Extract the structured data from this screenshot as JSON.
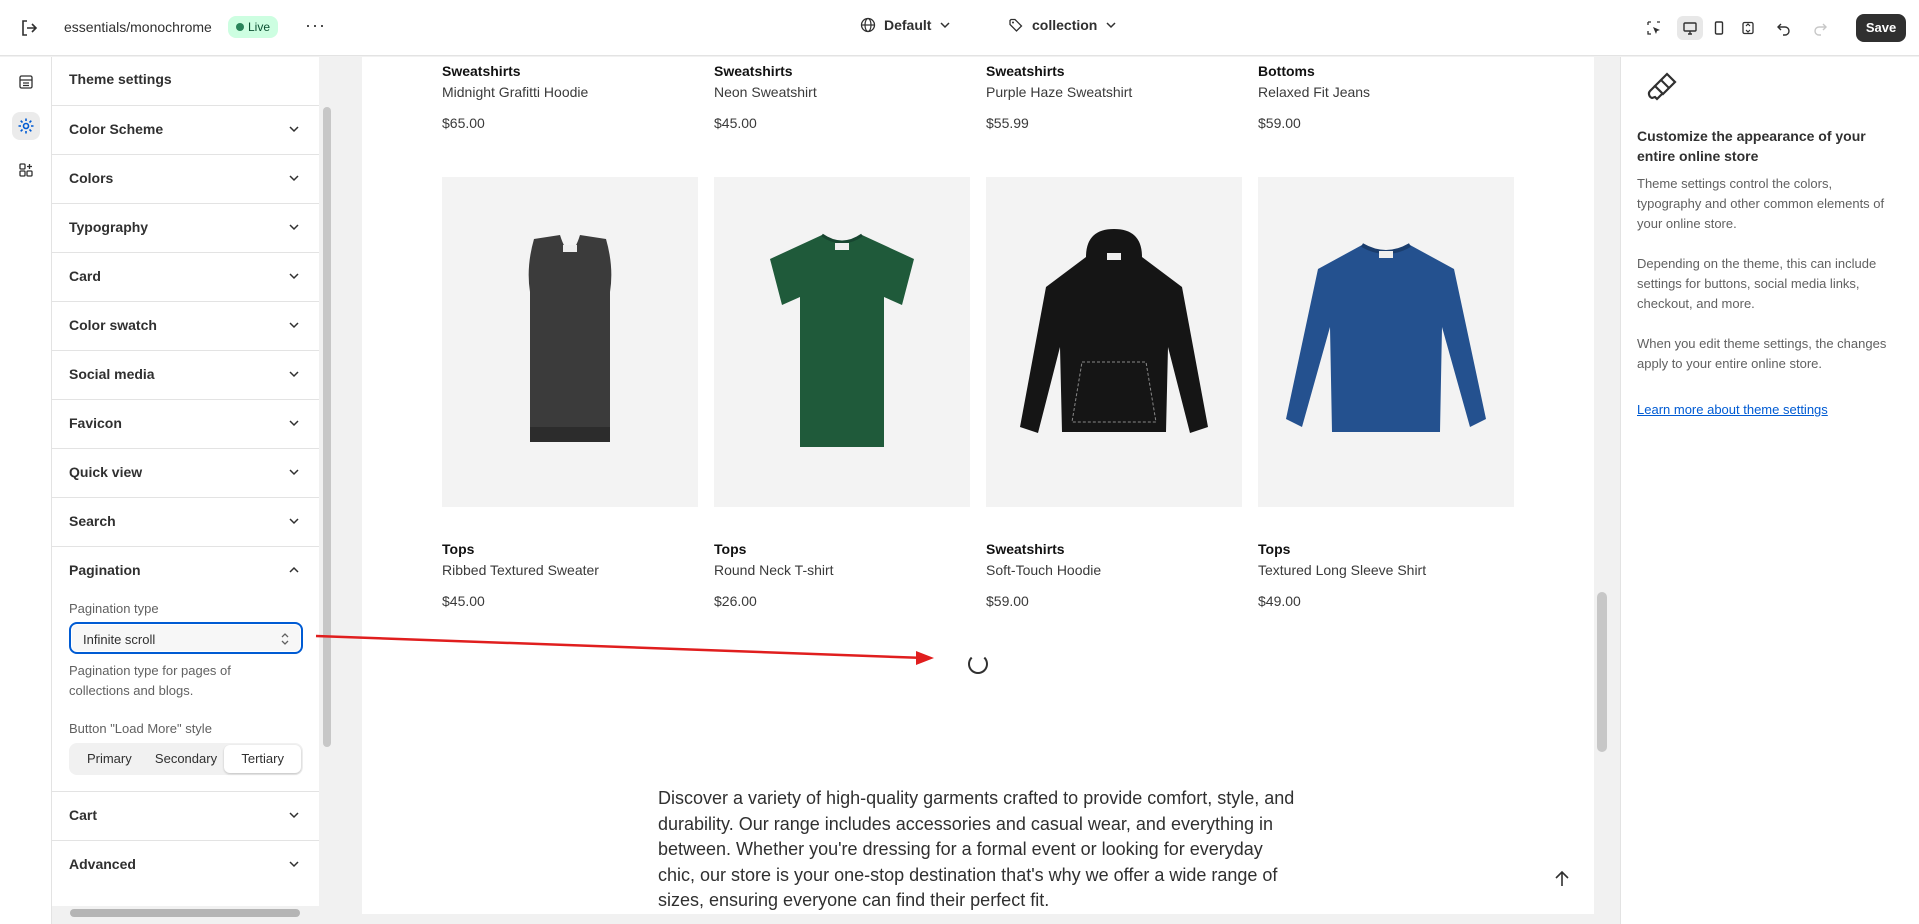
{
  "topbar": {
    "store_name": "essentials/monochrome",
    "status_badge": "Live",
    "more": "···",
    "theme_select": "Default",
    "template_select": "collection",
    "save_label": "Save"
  },
  "settings": {
    "title": "Theme settings",
    "sections": [
      {
        "label": "Color Scheme"
      },
      {
        "label": "Colors"
      },
      {
        "label": "Typography"
      },
      {
        "label": "Card"
      },
      {
        "label": "Color swatch"
      },
      {
        "label": "Social media"
      },
      {
        "label": "Favicon"
      },
      {
        "label": "Quick view"
      },
      {
        "label": "Search"
      },
      {
        "label": "Pagination"
      },
      {
        "label": "Cart"
      },
      {
        "label": "Advanced"
      }
    ],
    "pagination": {
      "type_label": "Pagination type",
      "type_value": "Infinite scroll",
      "help_text": "Pagination type for pages of collections and blogs.",
      "style_label": "Button \"Load More\" style",
      "style_options": [
        "Primary",
        "Secondary",
        "Tertiary"
      ],
      "style_selected": "Tertiary"
    }
  },
  "preview": {
    "top_row": [
      {
        "category": "Sweatshirts",
        "name": "Midnight Grafitti Hoodie",
        "price": "$65.00"
      },
      {
        "category": "Sweatshirts",
        "name": "Neon Sweatshirt",
        "price": "$45.00"
      },
      {
        "category": "Sweatshirts",
        "name": "Purple Haze Sweatshirt",
        "price": "$55.99"
      },
      {
        "category": "Bottoms",
        "name": "Relaxed Fit Jeans",
        "price": "$59.00"
      }
    ],
    "products": [
      {
        "category": "Tops",
        "name": "Ribbed Textured Sweater",
        "price": "$45.00",
        "color": "#3b3b3b"
      },
      {
        "category": "Tops",
        "name": "Round Neck T-shirt",
        "price": "$26.00",
        "color": "#1f5a3a"
      },
      {
        "category": "Sweatshirts",
        "name": "Soft-Touch Hoodie",
        "price": "$59.00",
        "color": "#151515"
      },
      {
        "category": "Tops",
        "name": "Textured Long Sleeve Shirt",
        "price": "$49.00",
        "color": "#24518f"
      }
    ],
    "about_text": "Discover a variety of high-quality garments crafted to provide comfort, style, and durability. Our range includes accessories and casual wear, and everything in between. Whether you're dressing for a formal event or looking for everyday chic, our store is your one-stop destination that's why we offer a wide range of sizes, ensuring everyone can find their perfect fit."
  },
  "info_panel": {
    "title": "Customize the appearance of your entire online store",
    "p1": "Theme settings control the colors, typography and other common elements of your online store.",
    "p2": "Depending on the theme, this can include settings for buttons, social media links, checkout, and more.",
    "p3": "When you edit theme settings, the changes apply to your entire online store.",
    "link": "Learn more about theme settings"
  },
  "colors": {
    "accent": "#005bd3",
    "annotation_arrow": "#e01e1e",
    "live_badge_bg": "#cdfee1"
  }
}
